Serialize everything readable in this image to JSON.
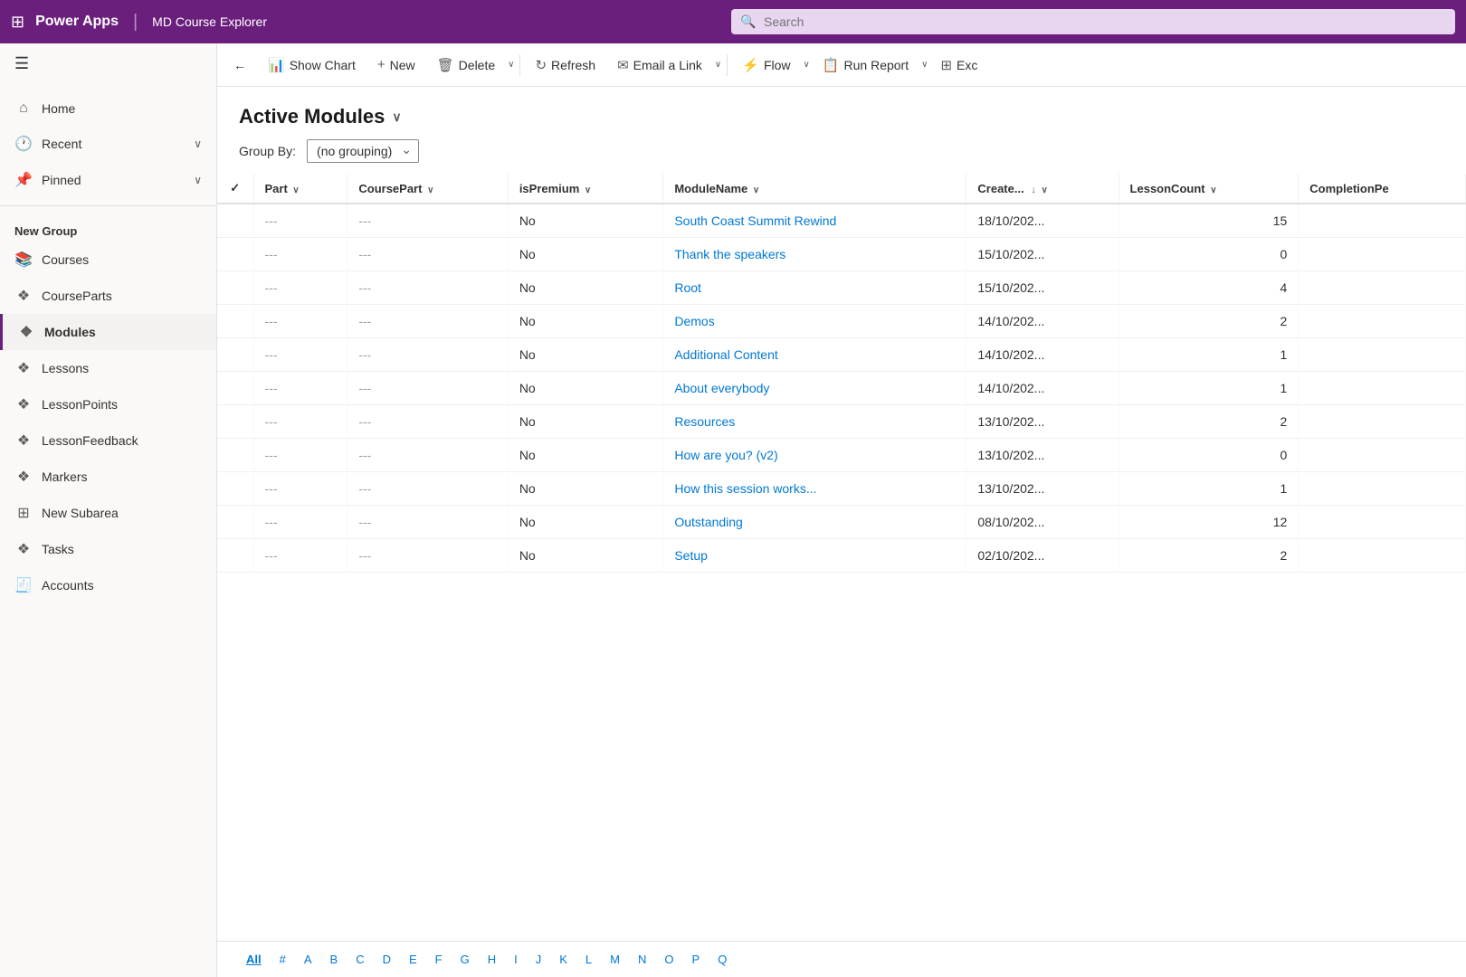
{
  "topbar": {
    "logo": "Power Apps",
    "divider": "|",
    "appname": "MD Course Explorer",
    "search_placeholder": "Search"
  },
  "sidebar": {
    "hamburger": "☰",
    "nav_items": [
      {
        "id": "home",
        "label": "Home",
        "icon": "⌂",
        "has_chevron": false
      },
      {
        "id": "recent",
        "label": "Recent",
        "icon": "🕐",
        "has_chevron": true
      },
      {
        "id": "pinned",
        "label": "Pinned",
        "icon": "📌",
        "has_chevron": true
      }
    ],
    "section_label": "New Group",
    "group_items": [
      {
        "id": "courses",
        "label": "Courses",
        "icon": "📚",
        "active": false
      },
      {
        "id": "courseparts",
        "label": "CourseParts",
        "icon": "🧩",
        "active": false
      },
      {
        "id": "modules",
        "label": "Modules",
        "icon": "🧩",
        "active": true
      },
      {
        "id": "lessons",
        "label": "Lessons",
        "icon": "🧩",
        "active": false
      },
      {
        "id": "lessonpoints",
        "label": "LessonPoints",
        "icon": "🧩",
        "active": false
      },
      {
        "id": "lessonfeedback",
        "label": "LessonFeedback",
        "icon": "🧩",
        "active": false
      },
      {
        "id": "markers",
        "label": "Markers",
        "icon": "🧩",
        "active": false
      },
      {
        "id": "newsubarea",
        "label": "New Subarea",
        "icon": "⊞",
        "active": false
      },
      {
        "id": "tasks",
        "label": "Tasks",
        "icon": "🧩",
        "active": false
      },
      {
        "id": "accounts",
        "label": "Accounts",
        "icon": "🧾",
        "active": false
      }
    ]
  },
  "command_bar": {
    "back_label": "←",
    "show_chart_label": "Show Chart",
    "new_label": "New",
    "delete_label": "Delete",
    "refresh_label": "Refresh",
    "email_link_label": "Email a Link",
    "flow_label": "Flow",
    "run_report_label": "Run Report",
    "excel_label": "Exc"
  },
  "page": {
    "title": "Active Modules",
    "group_by_label": "Group By:",
    "group_by_value": "(no grouping)"
  },
  "table": {
    "columns": [
      {
        "id": "check",
        "label": "✓",
        "sortable": false
      },
      {
        "id": "part",
        "label": "Part",
        "sortable": true,
        "has_chevron": true
      },
      {
        "id": "coursepart",
        "label": "CoursePart",
        "sortable": true,
        "has_chevron": true
      },
      {
        "id": "ispremium",
        "label": "isPremium",
        "sortable": true,
        "has_chevron": true
      },
      {
        "id": "modulename",
        "label": "ModuleName",
        "sortable": true,
        "has_chevron": true
      },
      {
        "id": "created",
        "label": "Create...",
        "sortable": true,
        "sort_dir": "↓",
        "has_chevron": true
      },
      {
        "id": "lessoncount",
        "label": "LessonCount",
        "sortable": true,
        "has_chevron": true
      },
      {
        "id": "completionpe",
        "label": "CompletionPe",
        "sortable": true
      }
    ],
    "rows": [
      {
        "part": "---",
        "coursepart": "---",
        "ispremium": "No",
        "modulename": "South Coast Summit Rewind",
        "created": "18/10/202...",
        "lessoncount": "15",
        "completionpe": ""
      },
      {
        "part": "---",
        "coursepart": "---",
        "ispremium": "No",
        "modulename": "Thank the speakers",
        "created": "15/10/202...",
        "lessoncount": "0",
        "completionpe": ""
      },
      {
        "part": "---",
        "coursepart": "---",
        "ispremium": "No",
        "modulename": "Root",
        "created": "15/10/202...",
        "lessoncount": "4",
        "completionpe": ""
      },
      {
        "part": "---",
        "coursepart": "---",
        "ispremium": "No",
        "modulename": "Demos",
        "created": "14/10/202...",
        "lessoncount": "2",
        "completionpe": ""
      },
      {
        "part": "---",
        "coursepart": "---",
        "ispremium": "No",
        "modulename": "Additional Content",
        "created": "14/10/202...",
        "lessoncount": "1",
        "completionpe": ""
      },
      {
        "part": "---",
        "coursepart": "---",
        "ispremium": "No",
        "modulename": "About everybody",
        "created": "14/10/202...",
        "lessoncount": "1",
        "completionpe": ""
      },
      {
        "part": "---",
        "coursepart": "---",
        "ispremium": "No",
        "modulename": "Resources",
        "created": "13/10/202...",
        "lessoncount": "2",
        "completionpe": ""
      },
      {
        "part": "---",
        "coursepart": "---",
        "ispremium": "No",
        "modulename": "How are you? (v2)",
        "created": "13/10/202...",
        "lessoncount": "0",
        "completionpe": ""
      },
      {
        "part": "---",
        "coursepart": "---",
        "ispremium": "No",
        "modulename": "How this session works...",
        "created": "13/10/202...",
        "lessoncount": "1",
        "completionpe": ""
      },
      {
        "part": "---",
        "coursepart": "---",
        "ispremium": "No",
        "modulename": "Outstanding",
        "created": "08/10/202...",
        "lessoncount": "12",
        "completionpe": ""
      },
      {
        "part": "---",
        "coursepart": "---",
        "ispremium": "No",
        "modulename": "Setup",
        "created": "02/10/202...",
        "lessoncount": "2",
        "completionpe": ""
      }
    ]
  },
  "pagination": {
    "letters": [
      "All",
      "#",
      "A",
      "B",
      "C",
      "D",
      "E",
      "F",
      "G",
      "H",
      "I",
      "J",
      "K",
      "L",
      "M",
      "N",
      "O",
      "P",
      "Q"
    ],
    "active": "All"
  }
}
